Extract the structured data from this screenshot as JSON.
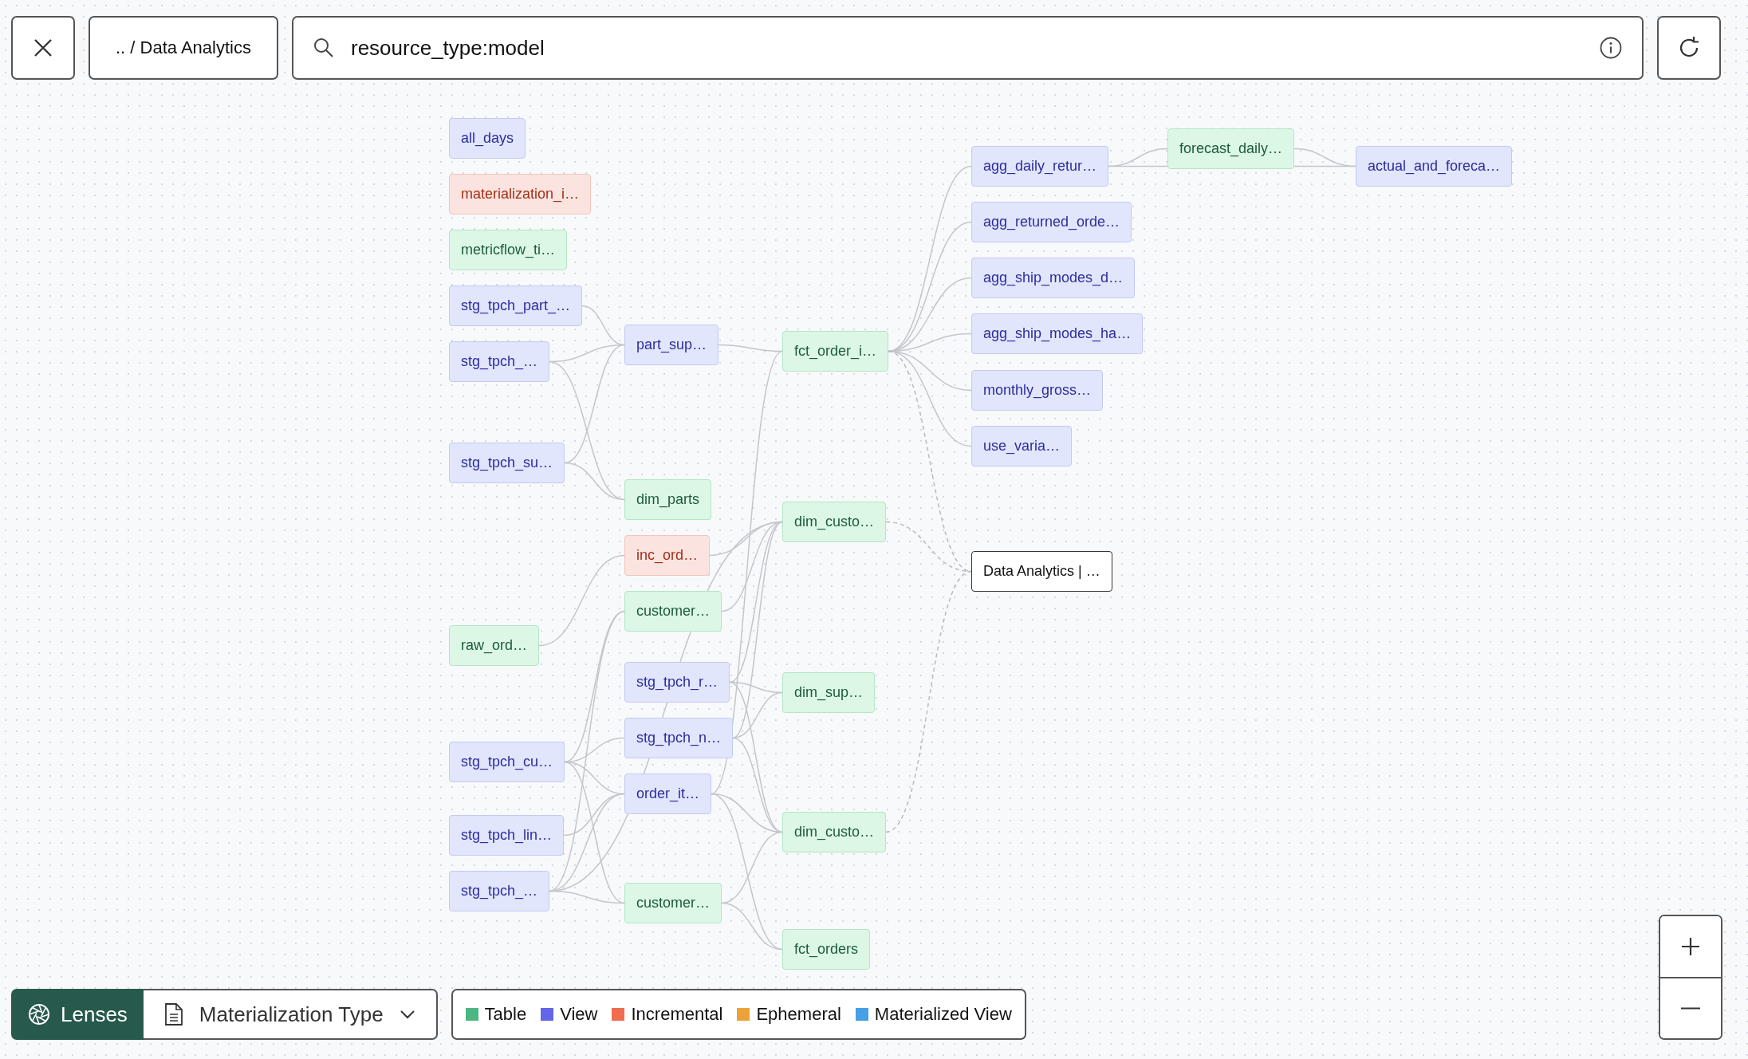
{
  "toolbar": {
    "breadcrumb": ".. / Data Analytics",
    "search": {
      "value": "resource_type:model"
    }
  },
  "graph": {
    "nodes": [
      {
        "label": "all_days",
        "kind": "view"
      },
      {
        "label": "materialization_i…",
        "kind": "incremental"
      },
      {
        "label": "metricflow_ti…",
        "kind": "table"
      },
      {
        "label": "stg_tpch_part_…",
        "kind": "view"
      },
      {
        "label": "stg_tpch_…",
        "kind": "view"
      },
      {
        "label": "stg_tpch_su…",
        "kind": "view"
      },
      {
        "label": "raw_ord…",
        "kind": "table"
      },
      {
        "label": "stg_tpch_cu…",
        "kind": "view"
      },
      {
        "label": "stg_tpch_lin…",
        "kind": "view"
      },
      {
        "label": "stg_tpch_…",
        "kind": "view"
      },
      {
        "label": "part_sup…",
        "kind": "view"
      },
      {
        "label": "dim_parts",
        "kind": "table"
      },
      {
        "label": "inc_ord…",
        "kind": "incremental"
      },
      {
        "label": "customer…",
        "kind": "table"
      },
      {
        "label": "stg_tpch_r…",
        "kind": "view"
      },
      {
        "label": "stg_tpch_n…",
        "kind": "view"
      },
      {
        "label": "order_it…",
        "kind": "view"
      },
      {
        "label": "customer…",
        "kind": "table"
      },
      {
        "label": "fct_order_i…",
        "kind": "table"
      },
      {
        "label": "dim_custo…",
        "kind": "table"
      },
      {
        "label": "dim_sup…",
        "kind": "table"
      },
      {
        "label": "dim_custo…",
        "kind": "table"
      },
      {
        "label": "fct_orders",
        "kind": "table"
      },
      {
        "label": "agg_daily_retur…",
        "kind": "view"
      },
      {
        "label": "agg_returned_orde…",
        "kind": "view"
      },
      {
        "label": "agg_ship_modes_d…",
        "kind": "view"
      },
      {
        "label": "agg_ship_modes_ha…",
        "kind": "view"
      },
      {
        "label": "monthly_gross…",
        "kind": "view"
      },
      {
        "label": "use_varia…",
        "kind": "view"
      },
      {
        "label": "Data Analytics | …",
        "kind": "exposure"
      },
      {
        "label": "forecast_daily…",
        "kind": "table"
      },
      {
        "label": "actual_and_foreca…",
        "kind": "view"
      }
    ]
  },
  "lens": {
    "label": "Lenses",
    "value": "Materialization Type"
  },
  "legend": [
    {
      "label": "Table",
      "color": "#4cb782"
    },
    {
      "label": "View",
      "color": "#6466e9"
    },
    {
      "label": "Incremental",
      "color": "#ef6c4f"
    },
    {
      "label": "Ephemeral",
      "color": "#eca23a"
    },
    {
      "label": "Materialized View",
      "color": "#46a0e6"
    }
  ]
}
